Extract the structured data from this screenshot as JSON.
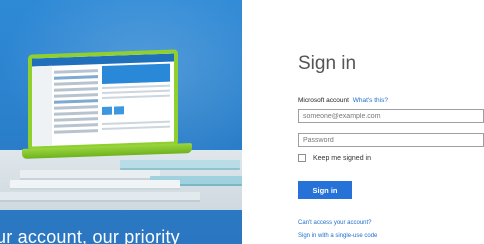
{
  "hero": {
    "tagline": "ur account, our priority"
  },
  "signin": {
    "title": "Sign in",
    "account_label": "Microsoft account",
    "whats_this_link": "What's this?",
    "email_placeholder": "someone@example.com",
    "password_placeholder": "Password",
    "keep_signed_in_label": "Keep me signed in",
    "keep_signed_in_checked": false,
    "submit_label": "Sign in",
    "cant_access_link": "Can't access your account?",
    "single_use_code_link": "Sign in with a single-use code"
  },
  "colors": {
    "accent": "#2672d8",
    "link": "#1e6fc8",
    "hero_blue": "#2a7fca"
  }
}
